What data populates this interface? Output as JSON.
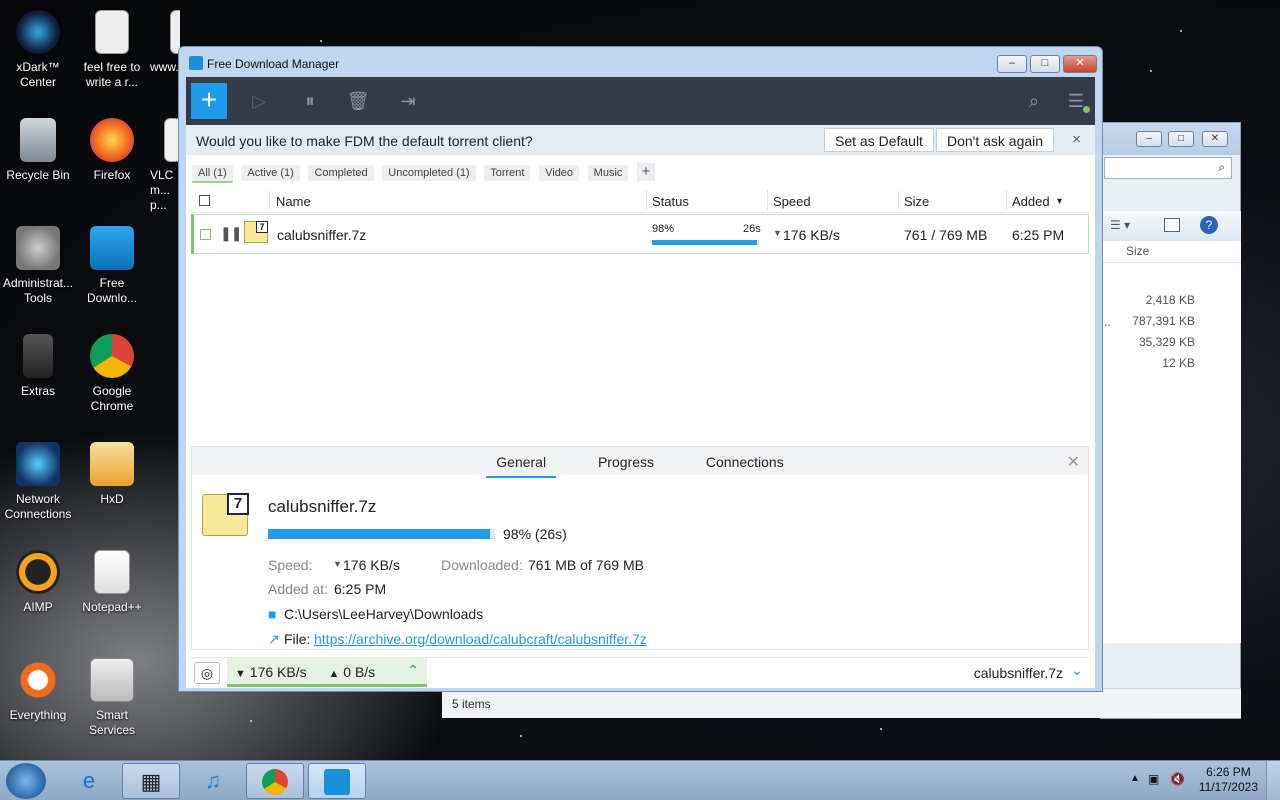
{
  "desktop": {
    "icons": [
      {
        "label": "xDark™ Center"
      },
      {
        "label": "feel free to write a r..."
      },
      {
        "label": "www..."
      },
      {
        "label": "Recycle Bin"
      },
      {
        "label": "Firefox"
      },
      {
        "label": "VLC m... p..."
      },
      {
        "label": "Administrat... Tools"
      },
      {
        "label": "Free Downlo..."
      },
      {
        "label": "Extras"
      },
      {
        "label": "Google Chrome"
      },
      {
        "label": "Network Connections"
      },
      {
        "label": "HxD"
      },
      {
        "label": "AIMP"
      },
      {
        "label": "Notepad++"
      },
      {
        "label": "Everything"
      },
      {
        "label": "Smart Services"
      }
    ]
  },
  "explorer": {
    "size_header": "Size",
    "sizes": [
      "2,418 KB",
      "787,391 KB",
      "35,329 KB",
      "12 KB"
    ],
    "status": "5 items"
  },
  "fdm": {
    "title": "Free Download Manager",
    "banner": {
      "text": "Would you like to make FDM the default torrent client?",
      "set_default": "Set as Default",
      "dont_ask": "Don't ask again",
      "close": "×"
    },
    "filters": [
      "All (1)",
      "Active (1)",
      "Completed",
      "Uncompleted (1)",
      "Torrent",
      "Video",
      "Music"
    ],
    "filter_add": "+",
    "columns": {
      "name": "Name",
      "status": "Status",
      "speed": "Speed",
      "size": "Size",
      "added": "Added"
    },
    "download": {
      "name": "calubsniffer.7z",
      "percent": "98%",
      "progress": 0.98,
      "eta": "26s",
      "speed": "176 KB/s",
      "size": "761 / 769 MB",
      "added": "6:25 PM"
    },
    "details": {
      "tabs": [
        "General",
        "Progress",
        "Connections"
      ],
      "name": "calubsniffer.7z",
      "progress_text": "98% (26s)",
      "speed_label": "Speed:",
      "speed_value": "176 KB/s",
      "downloaded_label": "Downloaded:",
      "downloaded_value": "761 MB of 769 MB",
      "added_label": "Added at:",
      "added_value": "6:25 PM",
      "folder": "C:\\Users\\LeeHarvey\\Downloads",
      "file_label": "File:",
      "file_url": "https://archive.org/download/calubcraft/calubsniffer.7z"
    },
    "statusbar": {
      "down": "176 KB/s",
      "up": "0 B/s",
      "current": "calubsniffer.7z"
    }
  },
  "taskbar": {
    "time": "6:26 PM",
    "date": "11/17/2023"
  },
  "colors": {
    "accent": "#1e9be9",
    "toolbar": "#353b48",
    "active_green": "#7cc36b"
  }
}
